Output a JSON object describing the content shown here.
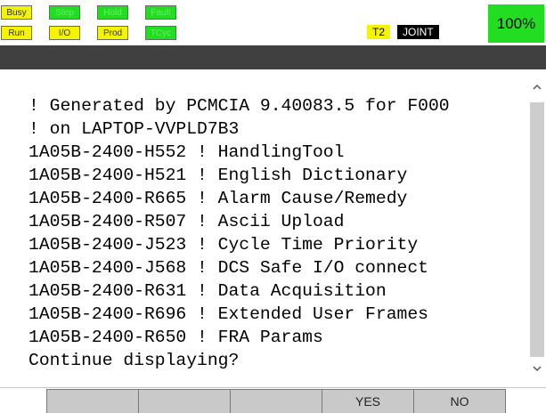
{
  "status_indicators": [
    {
      "label": "Busy",
      "color": "#f4f400"
    },
    {
      "label": "Step",
      "color": "#22dd22"
    },
    {
      "label": "Hold",
      "color": "#22dd22"
    },
    {
      "label": "Fault",
      "color": "#22dd22"
    },
    {
      "label": "Run",
      "color": "#f4f400"
    },
    {
      "label": "I/O",
      "color": "#f4f400"
    },
    {
      "label": "Prod",
      "color": "#f4f400"
    },
    {
      "label": "TCyc",
      "color": "#22dd22"
    }
  ],
  "tp_mode": "T2",
  "coord_system": "JOINT",
  "override": "100%",
  "lines": [
    "! Generated by PCMCIA 9.40083.5 for F000",
    "! on LAPTOP-VVPLD7B3",
    "1A05B-2400-H552 ! HandlingTool",
    "1A05B-2400-H521 ! English Dictionary",
    "1A05B-2400-R665 ! Alarm Cause/Remedy",
    "1A05B-2400-R507 ! Ascii Upload",
    "1A05B-2400-J523 ! Cycle Time Priority",
    "1A05B-2400-J568 ! DCS Safe I/O connect",
    "1A05B-2400-R631 ! Data Acquisition",
    "1A05B-2400-R696 ! Extended User Frames",
    "1A05B-2400-R650 ! FRA Params",
    "Continue displaying?"
  ],
  "scrollbar": {
    "up_icon": "chevron-up-icon",
    "down_icon": "chevron-down-icon"
  },
  "function_keys": [
    "",
    "",
    "",
    "YES",
    "NO"
  ]
}
